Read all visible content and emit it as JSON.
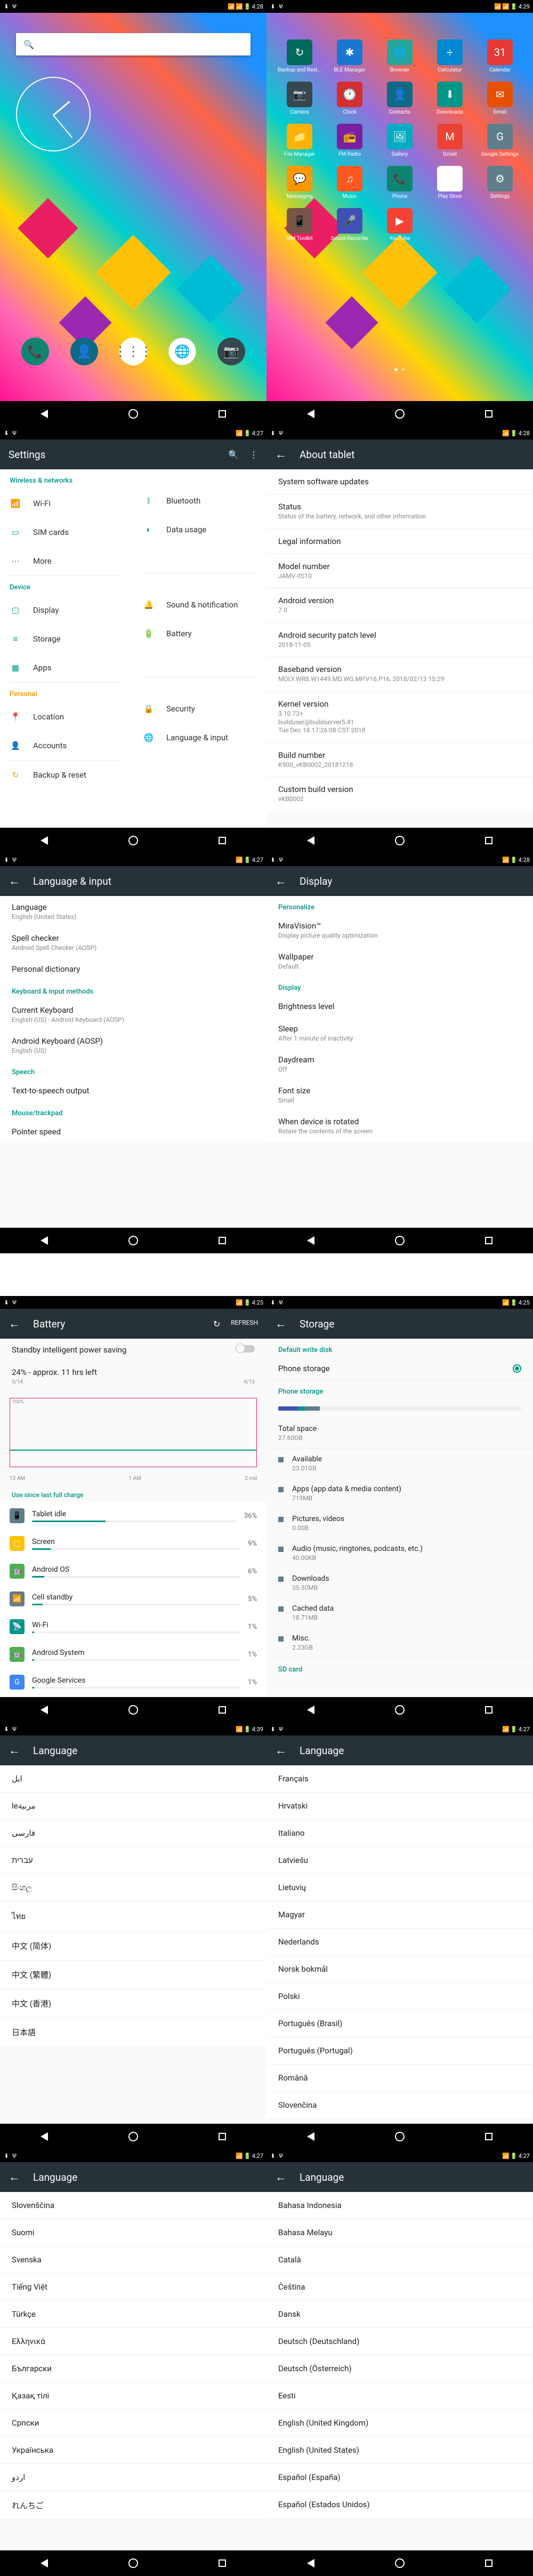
{
  "status_bar": {
    "time1": "4:28",
    "time2": "4:29",
    "time3": "4:27",
    "time4": "4:28",
    "time5": "4:25",
    "time6": "4:25",
    "time7": "4:39",
    "time8": "4:27",
    "time9": "4:27"
  },
  "search": {
    "placeholder": ""
  },
  "apps": [
    {
      "name": "Backup and Rest...",
      "color": "#00695c",
      "glyph": "↻"
    },
    {
      "name": "BLE Manager",
      "color": "#1976d2",
      "glyph": "✱"
    },
    {
      "name": "Browser",
      "color": "#26a69a",
      "glyph": "🌐"
    },
    {
      "name": "Calculator",
      "color": "#0288d1",
      "glyph": "÷"
    },
    {
      "name": "Calendar",
      "color": "#e53935",
      "glyph": "31"
    },
    {
      "name": "Camera",
      "color": "#37474f",
      "glyph": "📷"
    },
    {
      "name": "Clock",
      "color": "#d32f2f",
      "glyph": "🕐"
    },
    {
      "name": "Contacts",
      "color": "#0d6986",
      "glyph": "👤"
    },
    {
      "name": "Downloads",
      "color": "#009688",
      "glyph": "⬇"
    },
    {
      "name": "Email",
      "color": "#e65100",
      "glyph": "✉"
    },
    {
      "name": "File Manager",
      "color": "#ffb300",
      "glyph": "📁"
    },
    {
      "name": "FM Radio",
      "color": "#7b1fa2",
      "glyph": "📻"
    },
    {
      "name": "Gallery",
      "color": "#00acc1",
      "glyph": "🖼"
    },
    {
      "name": "Gmail",
      "color": "#ea4335",
      "glyph": "M"
    },
    {
      "name": "Google Settings",
      "color": "#607d8b",
      "glyph": "G"
    },
    {
      "name": "Messaging",
      "color": "#ff9800",
      "glyph": "💬"
    },
    {
      "name": "Music",
      "color": "#ff5722",
      "glyph": "♫"
    },
    {
      "name": "Phone",
      "color": "#0d8571",
      "glyph": "📞"
    },
    {
      "name": "Play Store",
      "color": "#fff",
      "glyph": "▶"
    },
    {
      "name": "Settings",
      "color": "#607d8b",
      "glyph": "⚙"
    },
    {
      "name": "SIM Toolkit",
      "color": "#795548",
      "glyph": "📱"
    },
    {
      "name": "Sound Recorder",
      "color": "#3f51b5",
      "glyph": "🎤"
    },
    {
      "name": "YouTube",
      "color": "#f44336",
      "glyph": "▶"
    }
  ],
  "settings": {
    "title": "Settings",
    "wireless_hdr": "Wireless & networks",
    "wifi": "Wi-Fi",
    "bluetooth": "Bluetooth",
    "sim": "SIM cards",
    "data": "Data usage",
    "more": "More",
    "device_hdr": "Device",
    "display": "Display",
    "sound": "Sound & notification",
    "storage": "Storage",
    "battery": "Battery",
    "apps": "Apps",
    "personal_hdr": "Personal",
    "location": "Location",
    "security": "Security",
    "accounts": "Accounts",
    "lang": "Language & input",
    "backup": "Backup & reset"
  },
  "about": {
    "title": "About tablet",
    "updates": "System software updates",
    "status": "Status",
    "status_sub": "Status of the battery, network, and other information",
    "legal": "Legal information",
    "model": "Model number",
    "model_val": "JAMV-0S10",
    "version": "Android version",
    "version_val": "7.0",
    "patch": "Android security patch level",
    "patch_val": "2018-11-05",
    "baseband": "Baseband version",
    "baseband_val": "MOLY.WR8.W1449.MD.WG.MP.V16.P16, 2018/02/13 15:29",
    "kernel": "Kernel version",
    "kernel_val": "3.10.72+\nbuilduser@buildserver5.41\nTue Dec 18 17:26:08 CST 2018",
    "build": "Build number",
    "build_val": "K900_vKB0002_20181218",
    "custom": "Custom build version",
    "custom_val": "vKB0002"
  },
  "lang_input": {
    "title": "Language & input",
    "language": "Language",
    "language_val": "English (United States)",
    "spell": "Spell checker",
    "spell_val": "Android Spell Checker (AOSP)",
    "dict": "Personal dictionary",
    "kb_hdr": "Keyboard & input methods",
    "current_kb": "Current Keyboard",
    "current_kb_val": "English (US) - Android Keyboard (AOSP)",
    "android_kb": "Android Keyboard (AOSP)",
    "android_kb_val": "English (US)",
    "speech_hdr": "Speech",
    "tts": "Text-to-speech output",
    "mouse_hdr": "Mouse/trackpad",
    "pointer": "Pointer speed"
  },
  "display_page": {
    "title": "Display",
    "pers_hdr": "Personalize",
    "mira": "MiraVision™",
    "mira_sub": "Display picture quality optimization",
    "wallpaper": "Wallpaper",
    "wallpaper_sub": "Default",
    "disp_hdr": "Display",
    "brightness": "Brightness level",
    "sleep": "Sleep",
    "sleep_sub": "After 1 minute of inactivity",
    "daydream": "Daydream",
    "daydream_sub": "Off",
    "font": "Font size",
    "font_sub": "Small",
    "rotate": "When device is rotated",
    "rotate_sub": "Rotate the contents of the screen"
  },
  "battery_page": {
    "title": "Battery",
    "refresh": "REFRESH",
    "standby": "Standby intelligent power saving",
    "stat": "24% - approx. 11 hrs left",
    "axis_l": "13 AM",
    "axis_m": "1 AM",
    "axis_r": "2 md",
    "date_l": "3/14",
    "date_r": "4/13",
    "full_charge": "Use since last full charge",
    "items": [
      {
        "name": "Tablet idle",
        "pct": "36%",
        "bar": 36,
        "color": "#607d8b",
        "glyph": "📱"
      },
      {
        "name": "Screen",
        "pct": "9%",
        "bar": 9,
        "color": "#ffc107",
        "glyph": "▢"
      },
      {
        "name": "Android OS",
        "pct": "6%",
        "bar": 6,
        "color": "#4caf50",
        "glyph": "🤖"
      },
      {
        "name": "Cell standby",
        "pct": "5%",
        "bar": 5,
        "color": "#607d8b",
        "glyph": "📶"
      },
      {
        "name": "Wi-Fi",
        "pct": "1%",
        "bar": 1,
        "color": "#009688",
        "glyph": "📡"
      },
      {
        "name": "Android System",
        "pct": "1%",
        "bar": 1,
        "color": "#4caf50",
        "glyph": "🤖"
      },
      {
        "name": "Google Services",
        "pct": "1%",
        "bar": 1,
        "color": "#4285f4",
        "glyph": "G"
      }
    ]
  },
  "storage_page": {
    "title": "Storage",
    "default_lbl": "Default write disk",
    "phone_storage": "Phone storage",
    "phone_storage_hdr": "Phone storage",
    "total": "Total space",
    "total_val": "27.60GB",
    "available": "Available",
    "available_val": "23.01GB",
    "apps": "Apps (app data & media content)",
    "apps_val": "719MB",
    "pics": "Pictures, videos",
    "pics_val": "0.00B",
    "audio": "Audio (music, ringtones, podcasts, etc.)",
    "audio_val": "40.00KB",
    "downloads": "Downloads",
    "downloads_val": "35.30MB",
    "cached": "Cached data",
    "cached_val": "18.71MB",
    "misc": "Misc.",
    "misc_val": "2.23GB",
    "sd_hdr": "SD card"
  },
  "lang_title": "Language",
  "languages_1": [
    "ایل",
    "leمربية",
    "فارسی",
    "עברית",
    "සිංහල",
    "ไทย",
    "中文 (简体)",
    "中文 (繁體)",
    "中文 (香港)",
    "日本語"
  ],
  "languages_2": [
    "Français",
    "Hrvatski",
    "Italiano",
    "Latviešu",
    "Lietuvių",
    "Magyar",
    "Nederlands",
    "Norsk bokmål",
    "Polski",
    "Português (Brasil)",
    "Português (Portugal)",
    "Română",
    "Slovenčina"
  ],
  "languages_3": [
    "Slovenščina",
    "Suomi",
    "Svenska",
    "Tiếng Việt",
    "Türkçe",
    "Ελληνικά",
    "Български",
    "Қазақ тілі",
    "Српски",
    "Українська",
    "اردو",
    "れんちご"
  ],
  "languages_4": [
    "Bahasa Indonesia",
    "Bahasa Melayu",
    "Català",
    "Čeština",
    "Dansk",
    "Deutsch (Deutschland)",
    "Deutsch (Österreich)",
    "Eesti",
    "English (United Kingdom)",
    "English (United States)",
    "Español (España)",
    "Español (Estados Unidos)"
  ]
}
